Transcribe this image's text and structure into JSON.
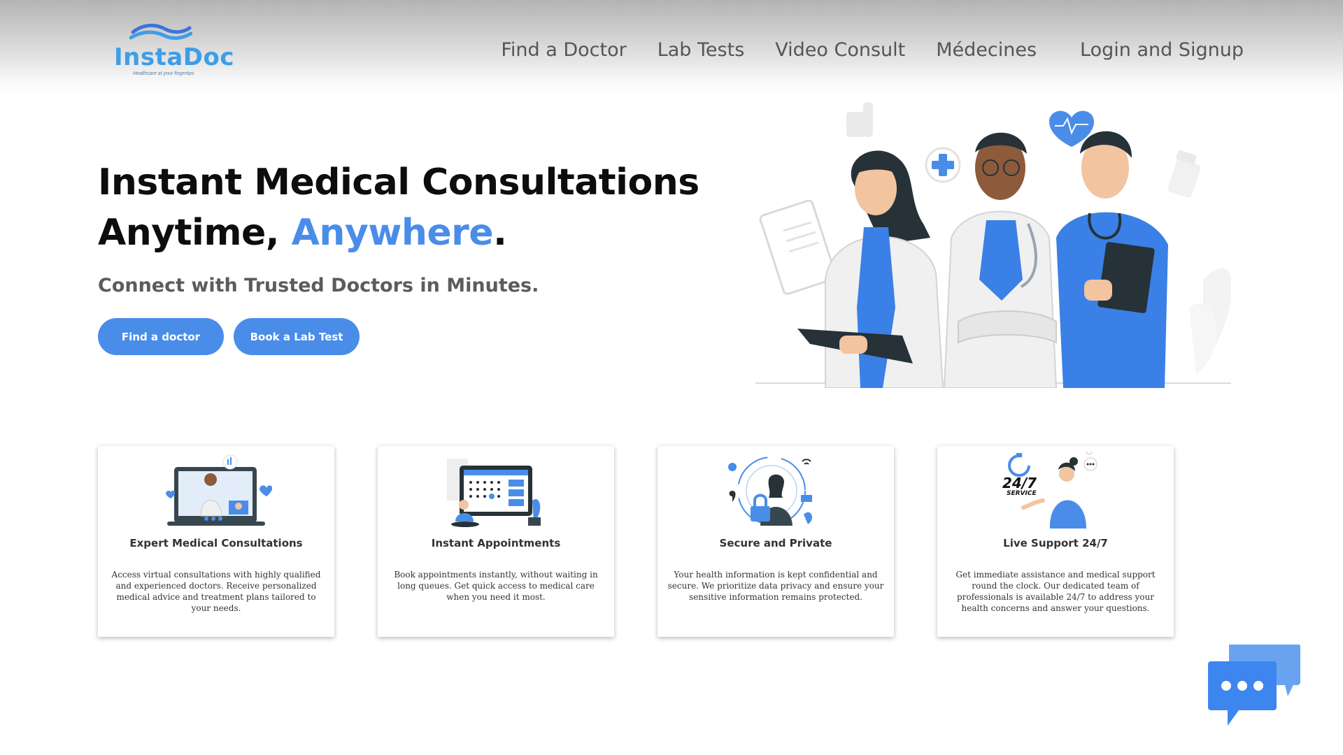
{
  "brand": {
    "name": "InstaDoc",
    "tagline": "Healthcare at your fingertips",
    "color": "#3d9ee8"
  },
  "nav": {
    "items": [
      {
        "label": "Find a Doctor"
      },
      {
        "label": "Lab Tests"
      },
      {
        "label": "Video Consult"
      },
      {
        "label": "Médecines"
      }
    ],
    "login_label": "Login and Signup"
  },
  "hero": {
    "title_line1": "Instant Medical Consultations",
    "title_line2_prefix": "Anytime, ",
    "title_line2_accent": "Anywhere",
    "title_line2_suffix": ".",
    "subtitle": "Connect with Trusted Doctors in Minutes.",
    "buttons": {
      "find_doctor": "Find a doctor",
      "book_lab": "Book a Lab Test"
    },
    "accent_color": "#4a8de8"
  },
  "features": [
    {
      "title": "Expert Medical Consultations",
      "text": "Access virtual consultations with highly qualified and experienced doctors. Receive personalized medical advice and treatment plans tailored to your needs.",
      "icon": "video-consultation-illustration"
    },
    {
      "title": "Instant Appointments",
      "text": "Book appointments instantly, without waiting in long queues. Get quick access to medical care when you need it most.",
      "icon": "calendar-booking-illustration"
    },
    {
      "title": "Secure and Private",
      "text": "Your health information is kept confidential and secure. We prioritize data privacy and ensure your sensitive information remains protected.",
      "icon": "security-lock-illustration"
    },
    {
      "title": "Live Support 24/7",
      "text": "Get immediate assistance and medical support round the clock. Our dedicated team of professionals is available 24/7 to address your health concerns and answer your questions.",
      "icon": "support-agent-illustration",
      "badge_24_7": "24/7",
      "badge_service": "SERVICE"
    }
  ],
  "chat_widget": {
    "icon": "chat-bubbles-icon"
  }
}
